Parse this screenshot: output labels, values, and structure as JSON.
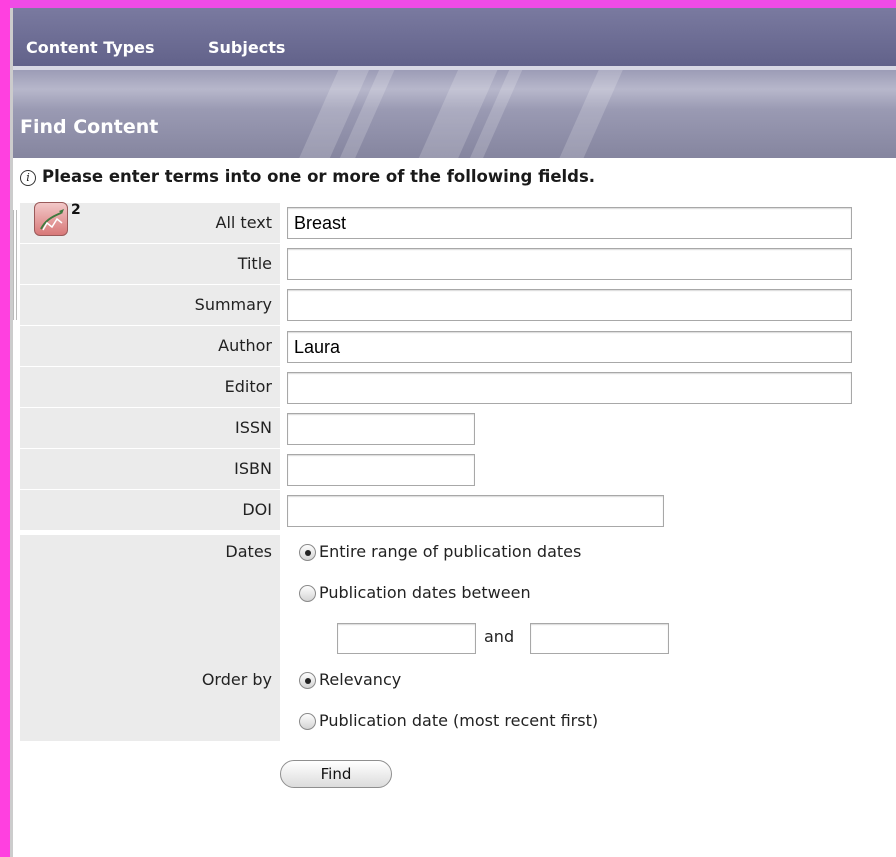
{
  "nav": {
    "items": [
      {
        "label": "Content Types"
      },
      {
        "label": "Subjects"
      }
    ]
  },
  "find": {
    "title": "Find Content",
    "info_text": "Please enter terms into one or more of the following fields.",
    "tool_badge": "2",
    "fields": {
      "all_text": {
        "label": "All text",
        "value": "Breast"
      },
      "title": {
        "label": "Title",
        "value": ""
      },
      "summary": {
        "label": "Summary",
        "value": ""
      },
      "author": {
        "label": "Author",
        "value": "Laura"
      },
      "editor": {
        "label": "Editor",
        "value": ""
      },
      "issn": {
        "label": "ISSN",
        "value": ""
      },
      "isbn": {
        "label": "ISBN",
        "value": ""
      },
      "doi": {
        "label": "DOI",
        "value": ""
      }
    },
    "dates": {
      "label": "Dates",
      "option_entire": "Entire range of publication dates",
      "option_between": "Publication dates between",
      "selected": "entire",
      "from": "",
      "and_label": "and",
      "to": ""
    },
    "order": {
      "label": "Order by",
      "option_relevancy": "Relevancy",
      "option_date": "Publication date (most recent first)",
      "selected": "relevancy"
    },
    "find_button": "Find"
  },
  "colors": {
    "frame": "#ff40e0",
    "nav_bg": "#6e6e96",
    "header_bg": "#9a9ab3",
    "label_bg": "#ebebeb"
  }
}
